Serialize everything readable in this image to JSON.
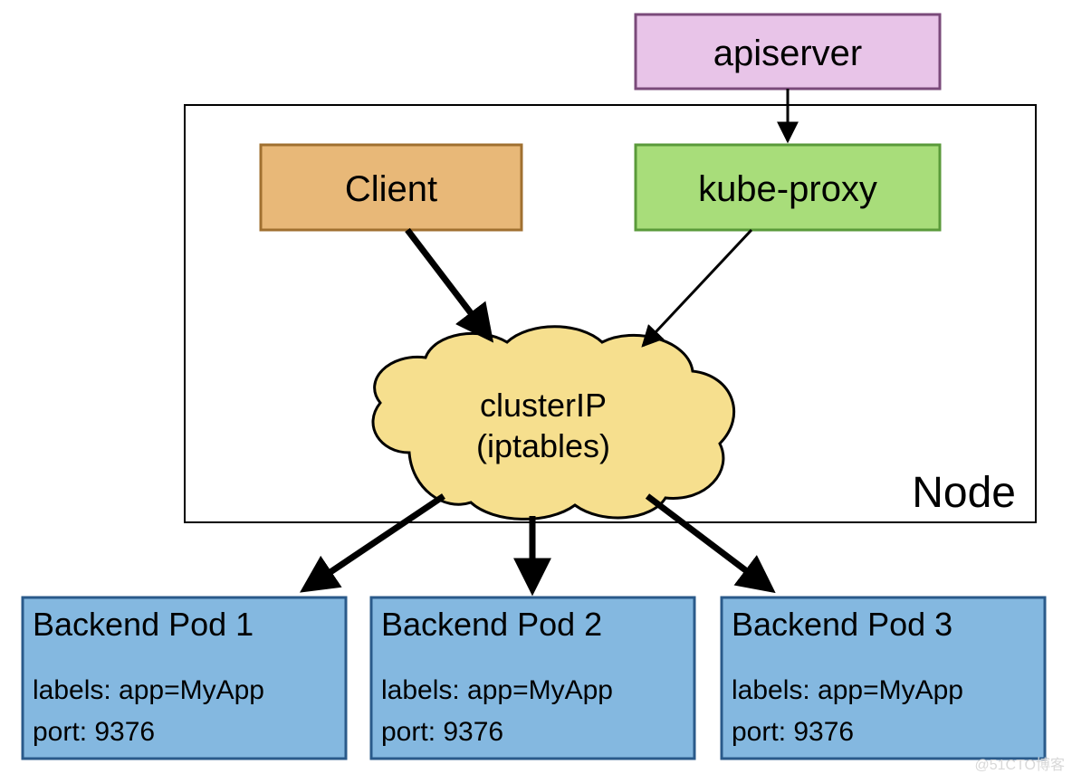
{
  "apiserver": {
    "label": "apiserver"
  },
  "client": {
    "label": "Client"
  },
  "kubeproxy": {
    "label": "kube-proxy"
  },
  "cluster": {
    "line1": "clusterIP",
    "line2": "(iptables)"
  },
  "node": {
    "label": "Node"
  },
  "pods": [
    {
      "title": "Backend Pod 1",
      "labels": "labels: app=MyApp",
      "port": "port: 9376"
    },
    {
      "title": "Backend Pod 2",
      "labels": "labels: app=MyApp",
      "port": "port: 9376"
    },
    {
      "title": "Backend Pod 3",
      "labels": "labels: app=MyApp",
      "port": "port: 9376"
    }
  ],
  "watermark": "@51CTO博客"
}
